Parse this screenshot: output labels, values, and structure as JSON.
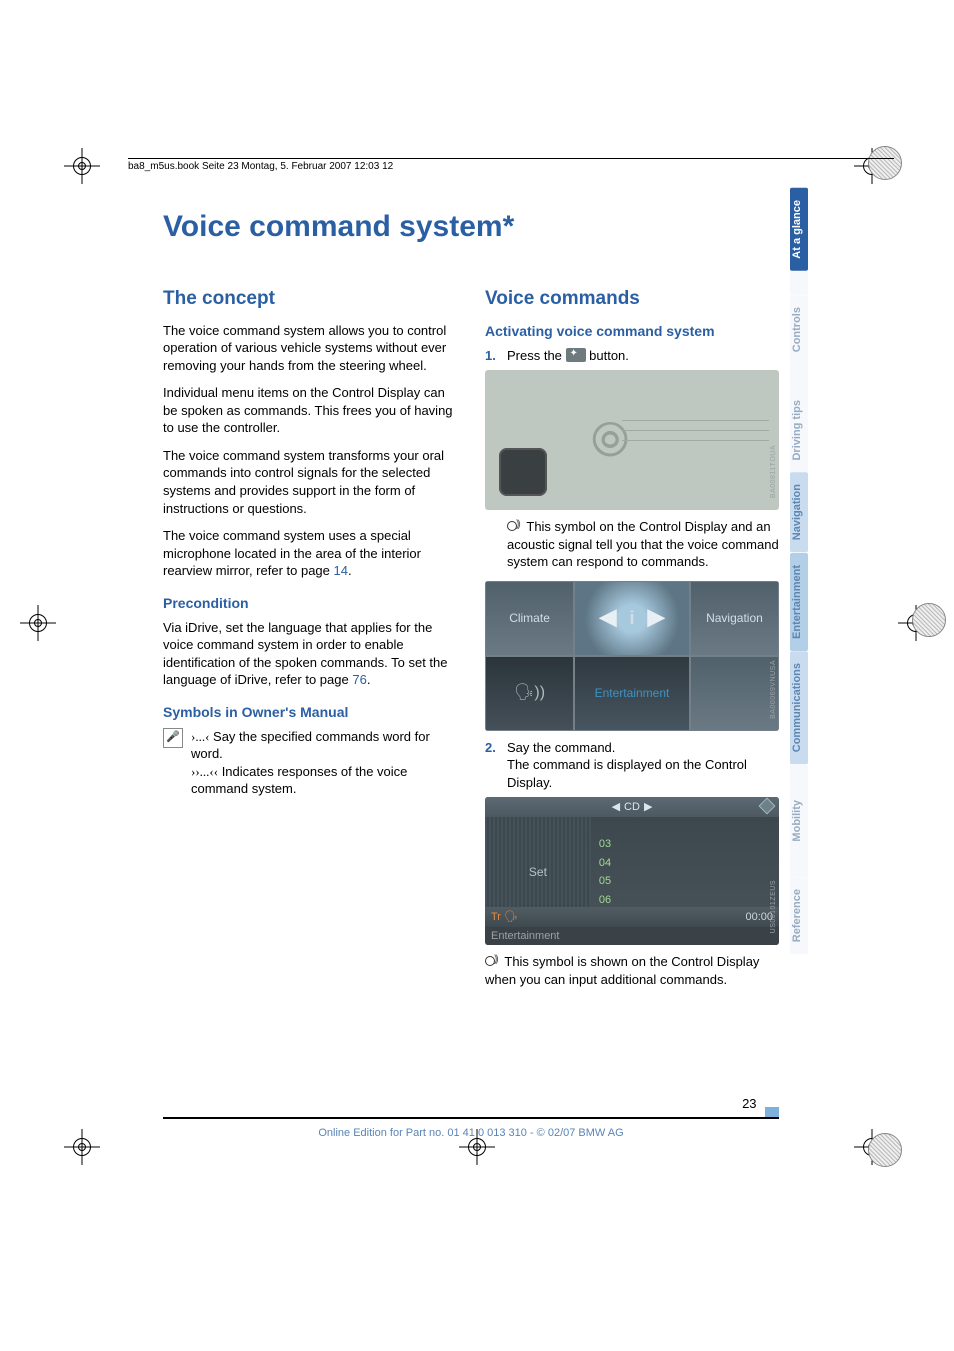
{
  "meta_header": "ba8_m5us.book  Seite 23  Montag, 5. Februar 2007  12:03 12",
  "title": "Voice command system*",
  "left": {
    "heading": "The concept",
    "p1": "The voice command system allows you to control operation of various vehicle systems without ever removing your hands from the steering wheel.",
    "p2": "Individual menu items on the Control Display can be spoken as commands. This frees you of having to use the controller.",
    "p3": "The voice command system transforms your oral commands into control signals for the selected systems and provides support in the form of instructions or questions.",
    "p4_a": "The voice command system uses a special microphone located in the area of the interior rearview mirror, refer to page ",
    "p4_link": "14",
    "precondition_h": "Precondition",
    "pre_a": "Via iDrive, set the language that applies for the voice command system in order to enable identification of the spoken commands. To set the language of iDrive, refer to page ",
    "pre_link": "76",
    "symbols_h": "Symbols in Owner's Manual",
    "sym1_mark": "›...‹",
    "sym1_text": " Say the specified commands word for word.",
    "sym2_mark": "››...‹‹",
    "sym2_text": " Indicates responses of the voice command system."
  },
  "right": {
    "heading": "Voice commands",
    "activate_h": "Activating voice command system",
    "step1_num": "1.",
    "step1_a": "Press the ",
    "step1_b": " button.",
    "after_fig1": " This symbol on the Control Display and an acoustic signal tell you that the voice command system can respond to commands.",
    "step2_num": "2.",
    "step2_a": "Say the command.",
    "step2_b": "The command is displayed on the Control Display.",
    "after_fig3": " This symbol is shown on the Control Display when you can input additional commands.",
    "idrive": {
      "climate": "Climate",
      "navigation": "Navigation",
      "entertainment": "Entertainment",
      "info": "i"
    },
    "cd": {
      "top_prev": "◀",
      "top_label": "CD",
      "top_next": "▶",
      "set": "Set",
      "n03": "03",
      "n04": "04",
      "n05": "05",
      "n06": "06",
      "tr": "Tr",
      "time": "00:00",
      "bottom": "Entertainment"
    },
    "figcodes": {
      "a": "BA00811TOUA",
      "b": "BA00069VNUSA",
      "c": "US00101ZEUS"
    }
  },
  "tabs": {
    "at_a_glance": "At a glance",
    "controls": "Controls",
    "driving_tips": "Driving tips",
    "navigation": "Navigation",
    "entertainment": "Entertainment",
    "communications": "Communications",
    "mobility": "Mobility",
    "reference": "Reference"
  },
  "page_number": "23",
  "online_line": "Online Edition for Part no. 01 41 0 013 310 - © 02/07 BMW AG"
}
